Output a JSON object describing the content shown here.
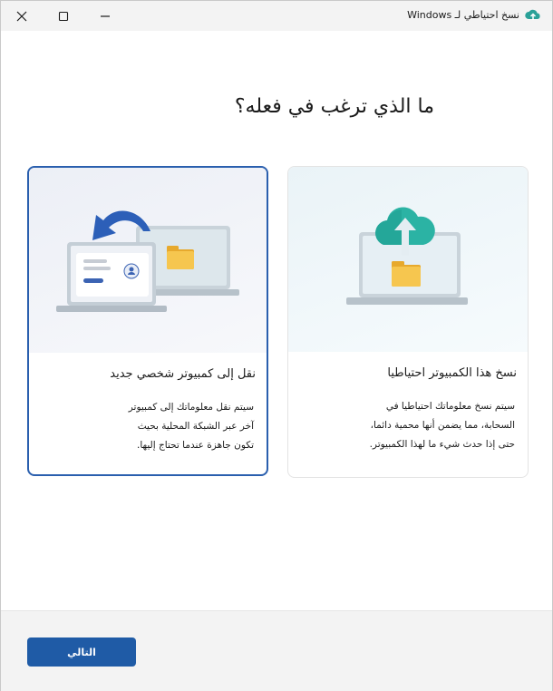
{
  "window": {
    "title": "نسخ احتياطي لـ Windows",
    "close_icon": "close-icon",
    "maximize_icon": "maximize-icon",
    "minimize_icon": "minimize-icon"
  },
  "main": {
    "heading": "ما الذي ترغب في فعله؟"
  },
  "cards": {
    "backup": {
      "title": "نسخ هذا الكمبيوتر احتياطيا",
      "desc_lines": [
        "سيتم نسخ معلوماتك احتياطيا في",
        "السحابة، مما يضمن أنها محمية دائما،",
        "حتى إذا حدث شيء ما لهذا الكمبيوتر."
      ],
      "icon": "cloud-upload-laptop-icon"
    },
    "transfer": {
      "title": "نقل إلى كمبيوتر شخصي جديد",
      "desc_lines": [
        "سيتم نقل معلوماتك إلى كمبيوتر",
        "آخر عبر الشبكة المحلية بحيث",
        "تكون جاهزة عندما تحتاج إليها."
      ],
      "icon": "transfer-laptops-icon",
      "selected": true
    }
  },
  "footer": {
    "next_label": "التالي"
  },
  "colors": {
    "accent": "#1f5ba6",
    "selected_border": "#2a5fae",
    "cloud_teal": "#2aa198",
    "folder_yellow": "#f2c14e"
  }
}
